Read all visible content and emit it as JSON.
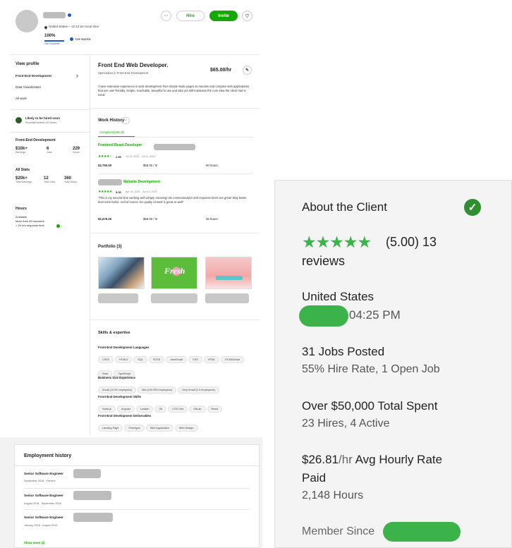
{
  "header": {
    "location": "United States – 12:13 pm local time",
    "job_success_value": "100%",
    "job_success_label": "Job Success",
    "badge": "TOP RATED",
    "more_label": "···",
    "hire_label": "Hire",
    "invite_label": "Invite",
    "heart_label": "♡"
  },
  "sidebar": {
    "view_profile": "View profile",
    "items": [
      {
        "label": "Front-End Development",
        "chevron": "›"
      },
      {
        "label": "Data Visualization"
      },
      {
        "label": "All work"
      }
    ],
    "likely_title": "Likely to be hired soon",
    "likely_sub": "Recently invited 101 times",
    "fed_title": "Front-End Development",
    "fed_stats": [
      {
        "value": "$10k+",
        "label": "Earnings"
      },
      {
        "value": "6",
        "label": "Jobs"
      },
      {
        "value": "229",
        "label": "Hours"
      }
    ],
    "all_title": "All Stats",
    "all_stats": [
      {
        "value": "$20k+",
        "label": "Total Earnings"
      },
      {
        "value": "12",
        "label": "Total Jobs"
      },
      {
        "value": "360",
        "label": "Total Hours"
      }
    ],
    "hours_title": "Hours",
    "hours_lines": [
      "Available",
      "More than 30 hrs/week",
      "< 24 hrs response time"
    ]
  },
  "main": {
    "title": "Front End Web Developer.",
    "subtitle": "Specializes in Front-End Development",
    "rate": "$65.00/hr",
    "description": "I have extensive experience in web development from simple static pages to reactive and complex web applications that are user-friendly, simple, reachable, beautiful to use and also yet still maintains the core idea the client had in mind.",
    "work_history_title": "Work History",
    "completed_tab": "Completed jobs (6)",
    "jobs": [
      {
        "title": "Frontend React Developer",
        "rating": "2.95",
        "dates": "Jul 22, 2021 - Jul 31, 2021",
        "stars": "★★★★☆",
        "earned": "$2,750.00",
        "rate": "$55.00 / hr",
        "hours": "50 hours",
        "quote": ""
      },
      {
        "title": "Website Development",
        "rating": "5.00",
        "dates": "Apr 26, 2021 - Jun 10, 2021",
        "stars": "★★★★★",
        "earned": "$2,475.00",
        "rate": "$55.00 / hr",
        "hours": "45 hours",
        "quote": "\"This is my second time working with Simply Amazing! His communication and response times are great! Way better than mine haha!. And of course, his quality of work is great as well\""
      }
    ],
    "portfolio_title": "Portfolio (3)",
    "skills_title": "Skills & expertise",
    "skill_groups": [
      {
        "title": "Front-End Development Languages",
        "chips": [
          "CSS3",
          "HTML5",
          "SQL",
          "SCSS",
          "JavaScript",
          "CSS",
          "HTML",
          "ECMAScript",
          "Sass",
          "TypeScript"
        ]
      },
      {
        "title": "Business Size Experience",
        "chips": [
          "Small (10-99 employees)",
          "Mid (100-999 employees)",
          "Very Small (1-9 employees)"
        ]
      },
      {
        "title": "Front-End Development Skills",
        "chips": [
          "Node.js",
          "Angular",
          "Lodash",
          "Git",
          "CSS Grid",
          "GitLab",
          "React"
        ]
      },
      {
        "title": "Front-End Development Deliverables",
        "chips": [
          "Landing Page",
          "Prototype",
          "Web Application",
          "Web Design"
        ]
      }
    ]
  },
  "employment": {
    "title": "Employment history",
    "entries": [
      {
        "role": "Senior Software Engineer",
        "dates": "September 2018 - Present"
      },
      {
        "role": "Senior Software Engineer",
        "dates": "August 2018 - September 2018"
      },
      {
        "role": "Senior Software Engineer",
        "dates": "January 2018 - August 2018"
      }
    ],
    "show_more": "Show more (3)"
  },
  "client": {
    "title": "About the Client",
    "stars": "★★★★★",
    "rating": "(5.00) 13",
    "reviews": "reviews",
    "country": "United States",
    "time": "04:25 PM",
    "jobs_posted": "31 Jobs Posted",
    "hire_rate": "55% Hire Rate, 1 Open Job",
    "total_spent": "Over $50,000 Total Spent",
    "hires": "23 Hires, 4 Active",
    "avg_rate_value": "$26.81",
    "avg_rate_unit": "/hr",
    "avg_rate_label": " Avg Hourly Rate",
    "paid": "Paid",
    "hours": "2,148 Hours",
    "member_since": "Member Since"
  },
  "colors": {
    "green": "#14a800",
    "accent_green": "#3cb34a",
    "verified_blue": "#1f57c3"
  }
}
